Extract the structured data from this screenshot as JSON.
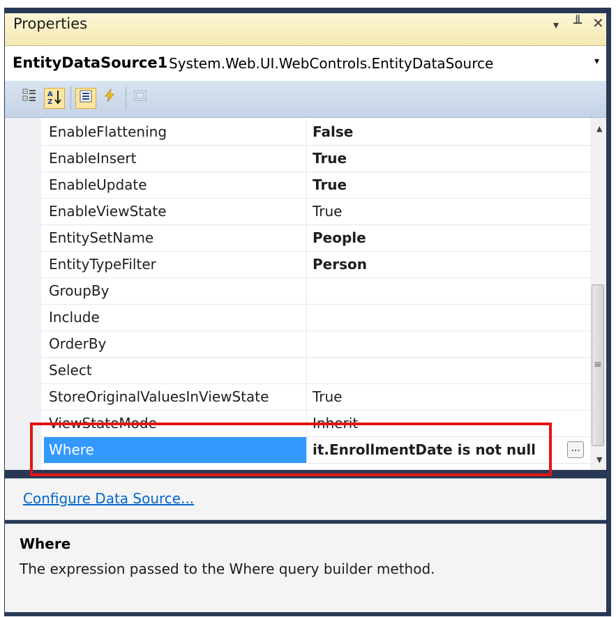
{
  "window": {
    "title": "Properties",
    "dropdown_glyph": "▾",
    "pin_glyph": "╨",
    "close_glyph": "✕"
  },
  "object_selector": {
    "name": "EntityDataSource1",
    "type": "System.Web.UI.WebControls.EntityDataSource",
    "dropdown_glyph": "▾"
  },
  "toolbar": {
    "categorized_icon": "categorized-icon",
    "alphabetical_icon": "alphabetical-icon",
    "properties_icon": "properties-icon",
    "events_icon": "events-icon",
    "property_pages_icon": "property-pages-icon"
  },
  "properties": [
    {
      "name": "EnableFlattening",
      "value": "False",
      "bold": true
    },
    {
      "name": "EnableInsert",
      "value": "True",
      "bold": true
    },
    {
      "name": "EnableUpdate",
      "value": "True",
      "bold": true
    },
    {
      "name": "EnableViewState",
      "value": "True",
      "bold": false
    },
    {
      "name": "EntitySetName",
      "value": "People",
      "bold": true
    },
    {
      "name": "EntityTypeFilter",
      "value": "Person",
      "bold": true
    },
    {
      "name": "GroupBy",
      "value": "",
      "bold": false
    },
    {
      "name": "Include",
      "value": "",
      "bold": false
    },
    {
      "name": "OrderBy",
      "value": "",
      "bold": false
    },
    {
      "name": "Select",
      "value": "",
      "bold": false
    },
    {
      "name": "StoreOriginalValuesInViewState",
      "value": "True",
      "bold": false
    },
    {
      "name": "ViewStateMode",
      "value": "Inherit",
      "bold": false
    },
    {
      "name": "Where",
      "value": "it.EnrollmentDate is not null",
      "bold": true,
      "selected": true
    }
  ],
  "ellipsis_label": "...",
  "commands": {
    "configure_link": "Configure Data Source..."
  },
  "description": {
    "title": "Where",
    "text": "The expression passed to the Where query builder method."
  },
  "colors": {
    "selection": "#3399ff",
    "highlight_border": "#e41414",
    "link": "#0066cc"
  }
}
